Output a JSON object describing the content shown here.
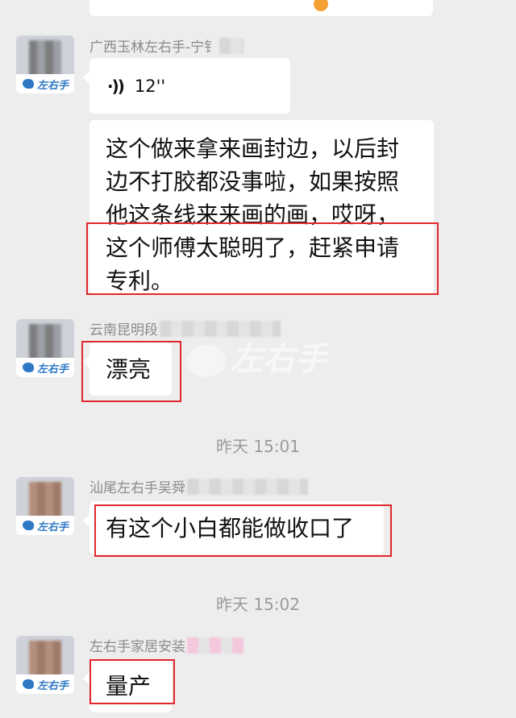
{
  "messages": [
    {
      "sender": "广西玉林左右手-宁钅",
      "voice_duration": "12''",
      "text": [
        "这个做来拿来画封边，以后封",
        "边不打胶都没事啦，如果按照",
        "他这条线来来画的画，哎呀，",
        "这个师傅太聪明了，赶紧申请",
        "专利。"
      ]
    },
    {
      "sender": "云南昆明段",
      "text": "漂亮"
    },
    {
      "timestamp": "昨天 15:01"
    },
    {
      "sender": "汕尾左右手吴舜",
      "text": "有这个小白都能做收口了"
    },
    {
      "timestamp": "昨天 15:02"
    },
    {
      "sender": "左右手家居安装",
      "text": "量产"
    }
  ],
  "avatar_logo": "左右手",
  "watermark": "左右手",
  "colors": {
    "highlight_box": "#e3262d",
    "accent": "#2f78c4",
    "background": "#ededed"
  }
}
